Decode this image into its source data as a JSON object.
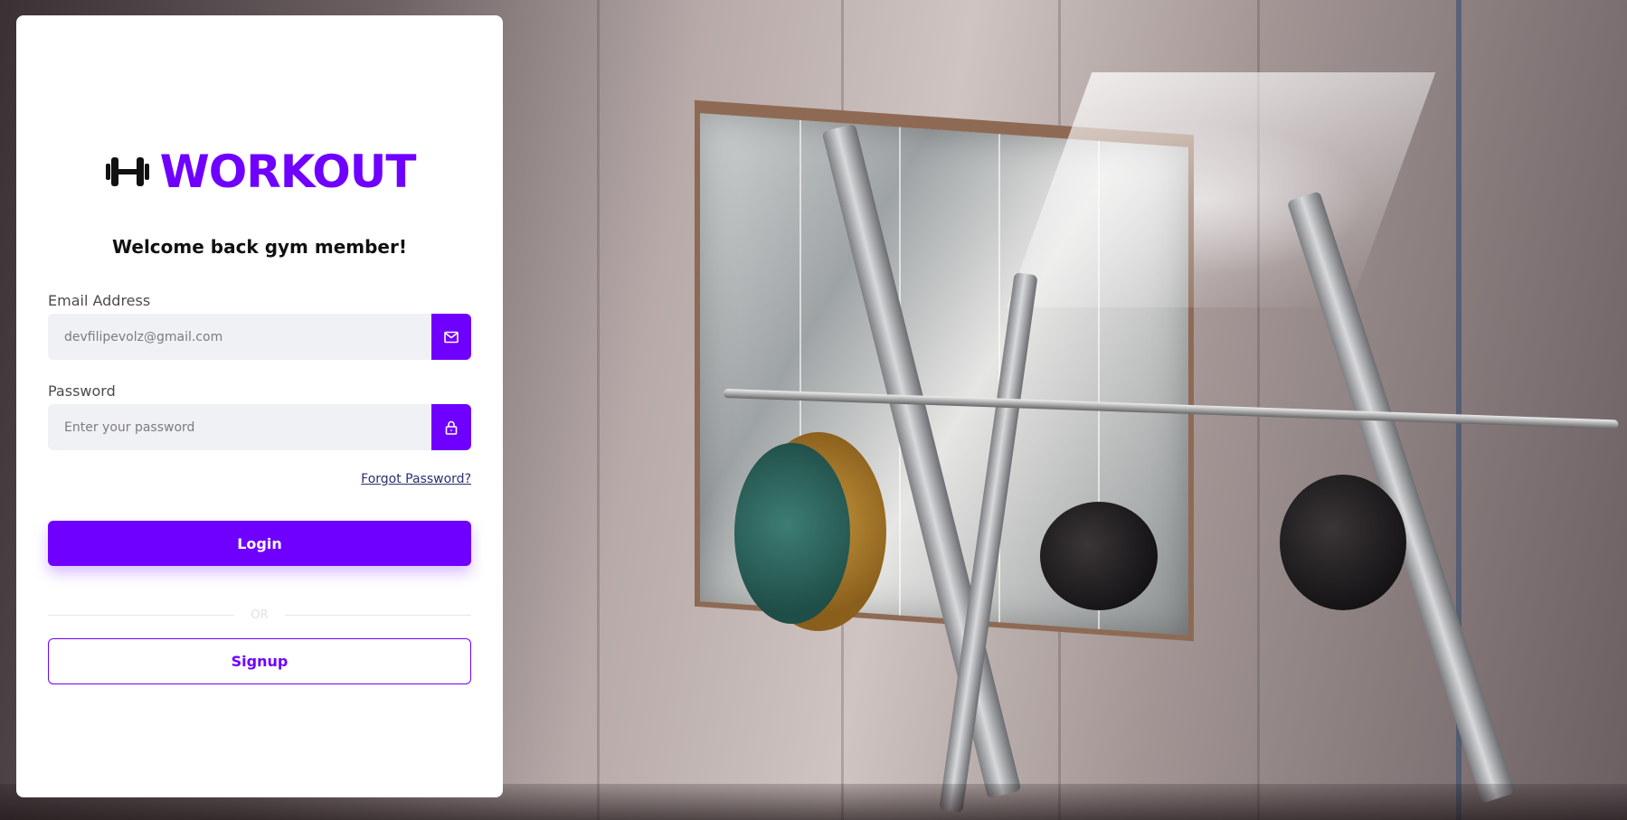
{
  "brand": {
    "name": "WORKOUT",
    "icon": "dumbbell-icon",
    "color": "#6f00ff"
  },
  "welcome": "Welcome back gym member!",
  "email": {
    "label": "Email Address",
    "value": "",
    "placeholder": "devfilipevolz@gmail.com",
    "icon": "mail-icon"
  },
  "password": {
    "label": "Password",
    "value": "",
    "placeholder": "Enter your password",
    "icon": "lock-icon"
  },
  "forgot_password": "Forgot Password?",
  "login_label": "Login",
  "divider_text": "OR",
  "signup_label": "Signup",
  "colors": {
    "accent": "#6f00ff",
    "input_background": "#f0f1f5",
    "panel_background": "#ffffff"
  }
}
